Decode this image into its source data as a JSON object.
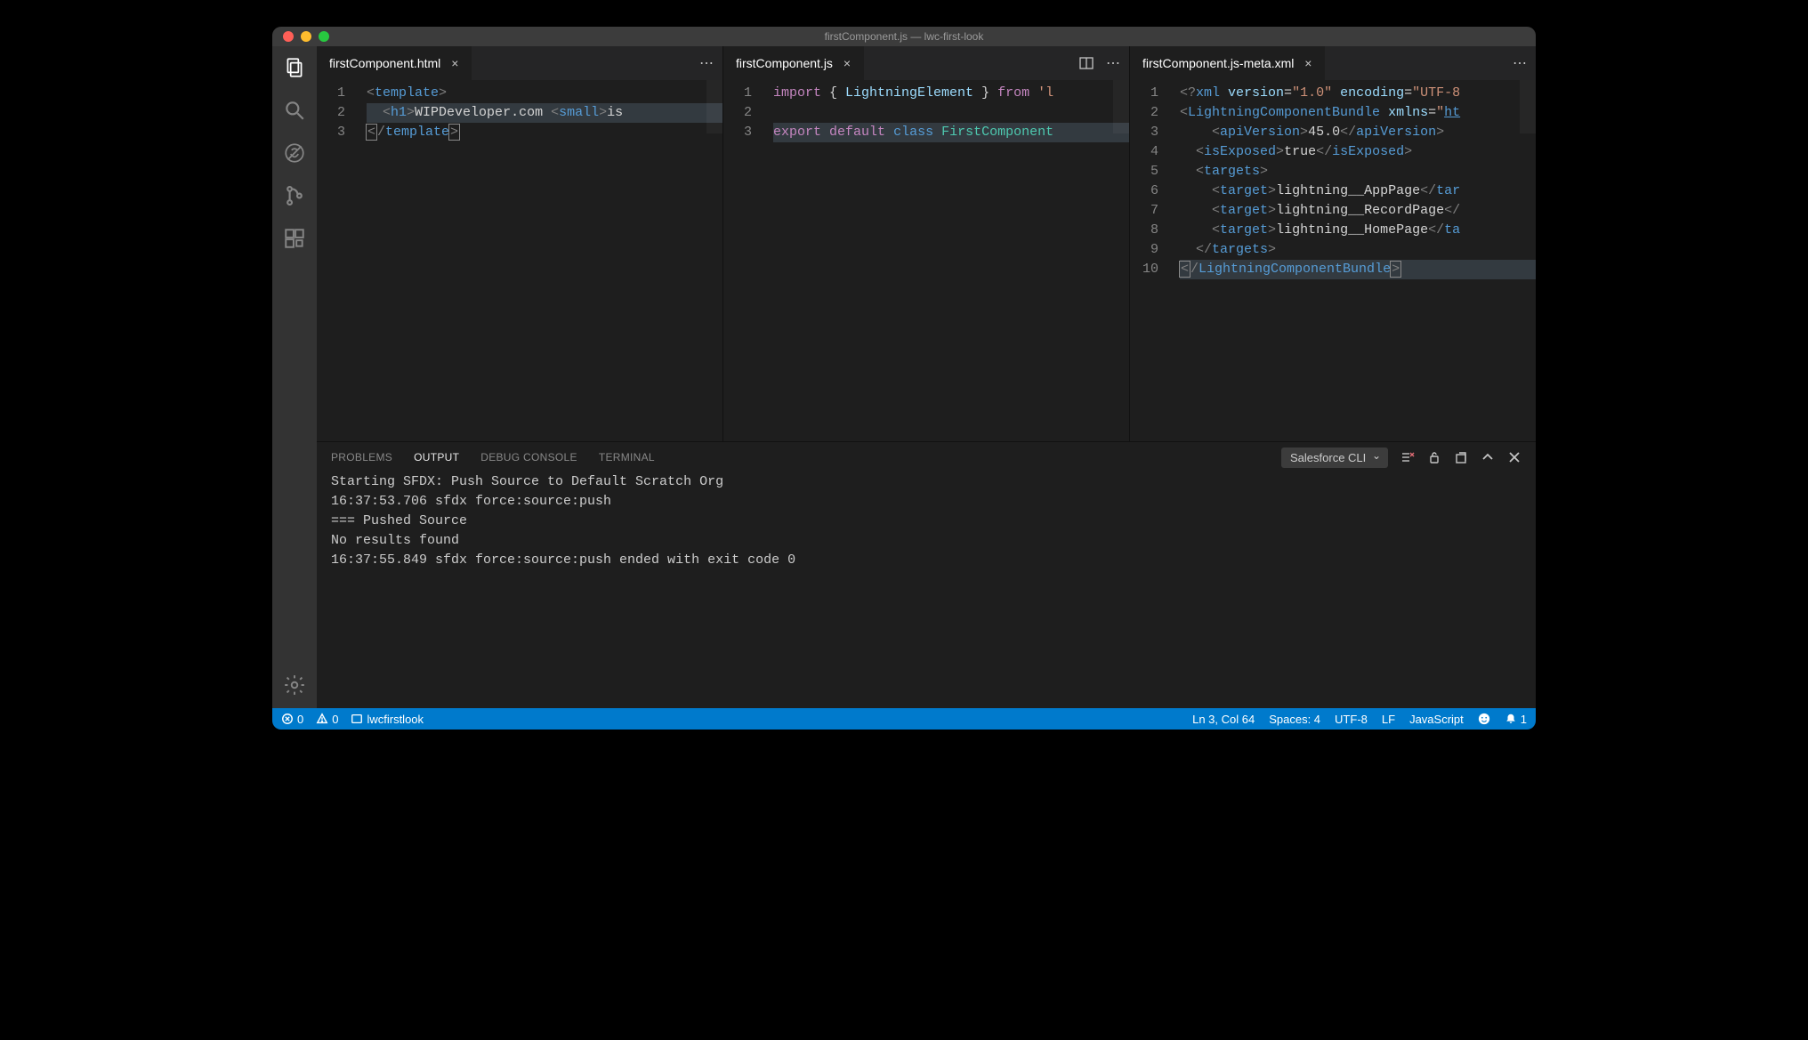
{
  "window": {
    "title": "firstComponent.js — lwc-first-look"
  },
  "activity_bar": {
    "items": [
      {
        "name": "explorer-icon"
      },
      {
        "name": "search-icon"
      },
      {
        "name": "debug-disabled-icon"
      },
      {
        "name": "source-control-icon"
      },
      {
        "name": "extensions-icon"
      }
    ],
    "bottom": {
      "name": "settings-icon"
    }
  },
  "editor_groups": [
    {
      "tab": {
        "label": "firstComponent.html",
        "active": true
      },
      "actions": [
        "more"
      ],
      "lines": [
        "1",
        "2",
        "3"
      ]
    },
    {
      "tab": {
        "label": "firstComponent.js",
        "active": true
      },
      "actions": [
        "split",
        "more"
      ],
      "lines": [
        "1",
        "2",
        "3"
      ]
    },
    {
      "tab": {
        "label": "firstComponent.js-meta.xml",
        "active": true
      },
      "actions": [
        "more"
      ],
      "lines": [
        "1",
        "2",
        "3",
        "4",
        "5",
        "6",
        "7",
        "8",
        "9",
        "10"
      ]
    }
  ],
  "code": {
    "html": {
      "l1": {
        "p": [
          "<",
          "template",
          ">"
        ]
      },
      "l2": {
        "p": [
          "  <",
          "h1",
          ">",
          "WIPDeveloper.com ",
          "<",
          "small",
          ">",
          "is"
        ]
      },
      "l3": {
        "p": [
          "<",
          "/",
          "template",
          ">"
        ]
      }
    },
    "js": {
      "l1": {
        "imp": "import",
        "brace": " { ",
        "el": "LightningElement",
        "brace2": " } ",
        "from": "from",
        "sp": " ",
        "q": "'l"
      },
      "l3": {
        "exp": "export",
        "sp": " ",
        "def": "default",
        "sp2": " ",
        "cls": "class",
        "sp3": " ",
        "name": "FirstComponent"
      }
    },
    "xml": {
      "l1": {
        "pi": "<?",
        "xml": "xml ",
        "a1": "version",
        "eq": "=",
        "v1": "\"1.0\"",
        "sp": " ",
        "a2": "encoding",
        "eq2": "=",
        "v2": "\"UTF-8"
      },
      "l2": {
        "o": "<",
        "n": "LightningComponentBundle",
        "sp": " ",
        "a": "xmlns",
        "eq": "=",
        "q": "\"",
        "v": "ht"
      },
      "l3": {
        "ind": "    ",
        "o": "<",
        "n": "apiVersion",
        "c": ">",
        "t": "45.0",
        "o2": "</",
        "n2": "apiVersion",
        "c2": ">"
      },
      "l4": {
        "ind": "  ",
        "o": "<",
        "n": "isExposed",
        "c": ">",
        "t": "true",
        "o2": "</",
        "n2": "isExposed",
        "c2": ">"
      },
      "l5": {
        "ind": "  ",
        "o": "<",
        "n": "targets",
        "c": ">"
      },
      "l6": {
        "ind": "    ",
        "o": "<",
        "n": "target",
        "c": ">",
        "t": "lightning__AppPage",
        "o2": "</",
        "n2": "tar"
      },
      "l7": {
        "ind": "    ",
        "o": "<",
        "n": "target",
        "c": ">",
        "t": "lightning__RecordPage",
        "o2": "</"
      },
      "l8": {
        "ind": "    ",
        "o": "<",
        "n": "target",
        "c": ">",
        "t": "lightning__HomePage",
        "o2": "</",
        "n2": "ta"
      },
      "l9": {
        "ind": "  ",
        "o": "</",
        "n": "targets",
        "c": ">"
      },
      "l10": {
        "o": "<",
        "sl": "/",
        "n": "LightningComponentBundle",
        "c": ">"
      }
    }
  },
  "panel": {
    "tabs": {
      "problems": "PROBLEMS",
      "output": "OUTPUT",
      "debug": "DEBUG CONSOLE",
      "terminal": "TERMINAL"
    },
    "select": {
      "value": "Salesforce CLI"
    },
    "output_lines": [
      "Starting SFDX: Push Source to Default Scratch Org",
      "",
      "16:37:53.706 sfdx force:source:push",
      "=== Pushed Source",
      "No results found",
      "16:37:55.849 sfdx force:source:push ended with exit code 0"
    ]
  },
  "status": {
    "errors": "0",
    "warnings": "0",
    "branch": "lwcfirstlook",
    "cursor": "Ln 3, Col 64",
    "spaces": "Spaces: 4",
    "encoding": "UTF-8",
    "eol": "LF",
    "lang": "JavaScript",
    "notifications": "1"
  }
}
